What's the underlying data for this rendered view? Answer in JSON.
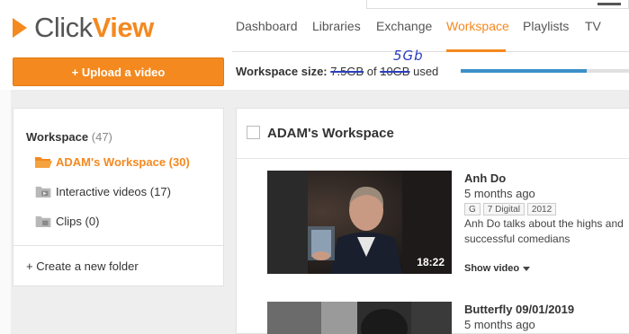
{
  "brand": {
    "name_part1": "Click",
    "name_part2": "View",
    "accent_color": "#f4891f"
  },
  "nav": {
    "items": [
      {
        "label": "Dashboard",
        "active": false
      },
      {
        "label": "Libraries",
        "active": false
      },
      {
        "label": "Exchange",
        "active": false
      },
      {
        "label": "Workspace",
        "active": true
      },
      {
        "label": "Playlists",
        "active": false
      },
      {
        "label": "TV",
        "active": false
      }
    ]
  },
  "toolbar": {
    "upload_label": "+ Upload a video"
  },
  "workspace_size": {
    "label": "Workspace size:",
    "used": "7.5GB",
    "of": "of",
    "total": "10GB",
    "suffix": "used",
    "annotation": "5Gb",
    "used_fraction": 0.75
  },
  "sidebar": {
    "title": "Workspace",
    "count": "(47)",
    "items": [
      {
        "label": "ADAM's Workspace (30)",
        "icon": "folder-open-icon",
        "active": true
      },
      {
        "label": "Interactive videos (17)",
        "icon": "folder-interactive-icon",
        "active": false
      },
      {
        "label": "Clips (0)",
        "icon": "folder-clips-icon",
        "active": false
      }
    ],
    "create_folder": "+ Create a new folder"
  },
  "content": {
    "title": "ADAM's Workspace",
    "videos": [
      {
        "title": "Anh Do",
        "age": "5 months ago",
        "tags": [
          "G",
          "7 Digital",
          "2012"
        ],
        "description_line1": "Anh Do talks about the highs and",
        "description_line2": "successful comedians",
        "duration": "18:22",
        "show_label": "Show video"
      },
      {
        "title": "Butterfly 09/01/2019",
        "age": "5 months ago"
      }
    ]
  }
}
